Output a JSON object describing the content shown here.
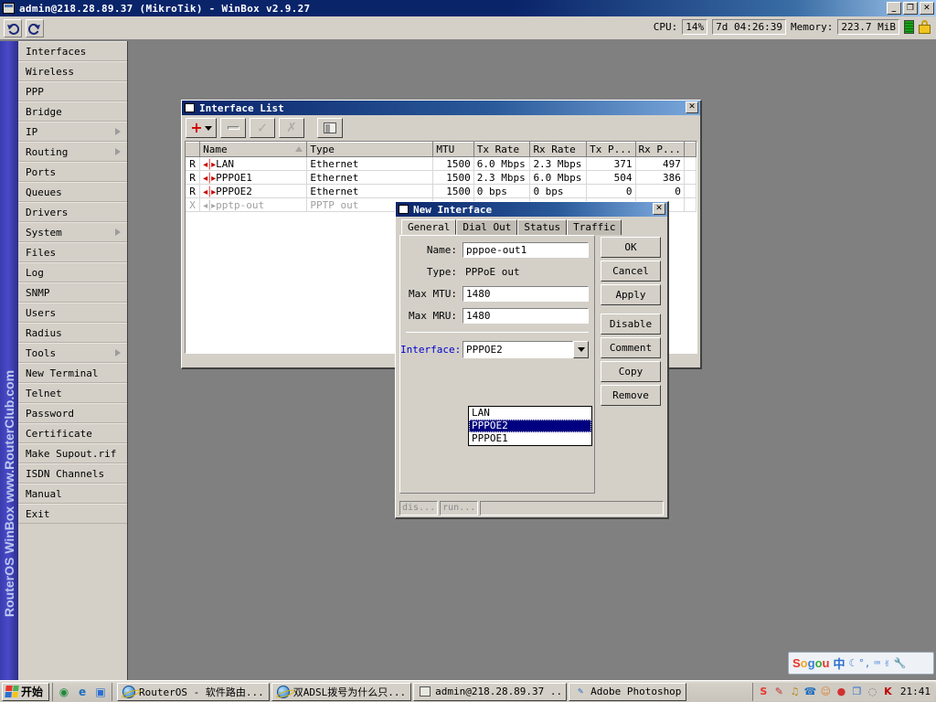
{
  "window": {
    "title": "admin@218.28.89.37 (MikroTik) - WinBox v2.9.27",
    "minimize": "_",
    "restore": "❐",
    "close": "✕"
  },
  "statusbar": {
    "cpu_label": "CPU:",
    "cpu_value": "14%",
    "uptime": "7d 04:26:39",
    "memory_label": "Memory:",
    "memory_value": "223.7 MiB"
  },
  "sidebar": {
    "watermark": "RouterOS WinBox   www.RouterClub.com",
    "items": [
      {
        "label": "Interfaces",
        "submenu": false
      },
      {
        "label": "Wireless",
        "submenu": false
      },
      {
        "label": "PPP",
        "submenu": false
      },
      {
        "label": "Bridge",
        "submenu": false
      },
      {
        "label": "IP",
        "submenu": true
      },
      {
        "label": "Routing",
        "submenu": true
      },
      {
        "label": "Ports",
        "submenu": false
      },
      {
        "label": "Queues",
        "submenu": false
      },
      {
        "label": "Drivers",
        "submenu": false
      },
      {
        "label": "System",
        "submenu": true
      },
      {
        "label": "Files",
        "submenu": false
      },
      {
        "label": "Log",
        "submenu": false
      },
      {
        "label": "SNMP",
        "submenu": false
      },
      {
        "label": "Users",
        "submenu": false
      },
      {
        "label": "Radius",
        "submenu": false
      },
      {
        "label": "Tools",
        "submenu": true
      },
      {
        "label": "New Terminal",
        "submenu": false
      },
      {
        "label": "Telnet",
        "submenu": false
      },
      {
        "label": "Password",
        "submenu": false
      },
      {
        "label": "Certificate",
        "submenu": false
      },
      {
        "label": "Make Supout.rif",
        "submenu": false
      },
      {
        "label": "ISDN Channels",
        "submenu": false
      },
      {
        "label": "Manual",
        "submenu": false
      },
      {
        "label": "Exit",
        "submenu": false
      }
    ]
  },
  "interface_list": {
    "title": "Interface List",
    "close": "✕",
    "toolbar": {
      "add": "+",
      "remove": "−",
      "enable": "✓",
      "disable": "✗",
      "comment": "window"
    },
    "columns": [
      "",
      "Name",
      "Type",
      "MTU",
      "Tx Rate",
      "Rx Rate",
      "Tx P...",
      "Rx P...",
      ""
    ],
    "rows": [
      {
        "flag": "R",
        "name": "LAN",
        "type": "Ethernet",
        "mtu": "1500",
        "tx_rate": "6.0 Mbps",
        "rx_rate": "2.3 Mbps",
        "tx_packets": "371",
        "rx_packets": "497",
        "disabled": false
      },
      {
        "flag": "R",
        "name": "PPPOE1",
        "type": "Ethernet",
        "mtu": "1500",
        "tx_rate": "2.3 Mbps",
        "rx_rate": "6.0 Mbps",
        "tx_packets": "504",
        "rx_packets": "386",
        "disabled": false
      },
      {
        "flag": "R",
        "name": "PPPOE2",
        "type": "Ethernet",
        "mtu": "1500",
        "tx_rate": "0 bps",
        "rx_rate": "0 bps",
        "tx_packets": "0",
        "rx_packets": "0",
        "disabled": false
      },
      {
        "flag": "X",
        "name": "pptp-out",
        "type": "PPTP out",
        "mtu": "",
        "tx_rate": "",
        "rx_rate": "",
        "tx_packets": "",
        "rx_packets": "",
        "disabled": true
      }
    ]
  },
  "new_interface": {
    "title": "New Interface",
    "close": "✕",
    "tabs": [
      {
        "label": "General",
        "active": true
      },
      {
        "label": "Dial Out",
        "active": false
      },
      {
        "label": "Status",
        "active": false
      },
      {
        "label": "Traffic",
        "active": false
      }
    ],
    "fields": {
      "name_label": "Name:",
      "name_value": "pppoe-out1",
      "type_label": "Type:",
      "type_value": "PPPoE out",
      "max_mtu_label": "Max MTU:",
      "max_mtu_value": "1480",
      "max_mru_label": "Max MRU:",
      "max_mru_value": "1480",
      "interface_label": "Interface:",
      "interface_value": "PPPOE2"
    },
    "dropdown": {
      "options": [
        {
          "label": "LAN",
          "selected": false
        },
        {
          "label": "PPPOE2",
          "selected": true
        },
        {
          "label": "PPPOE1",
          "selected": false
        }
      ]
    },
    "buttons": [
      {
        "label": "OK",
        "gap": false
      },
      {
        "label": "Cancel",
        "gap": false
      },
      {
        "label": "Apply",
        "gap": false
      },
      {
        "label": "Disable",
        "gap": true
      },
      {
        "label": "Comment",
        "gap": false
      },
      {
        "label": "Copy",
        "gap": false
      },
      {
        "label": "Remove",
        "gap": false
      }
    ],
    "status": {
      "disabled": "dis...",
      "running": "run...",
      "message": ""
    }
  },
  "sogou": {
    "logo": [
      {
        "ch": "S",
        "cls": "s1"
      },
      {
        "ch": "o",
        "cls": "s2"
      },
      {
        "ch": "g",
        "cls": "s3"
      },
      {
        "ch": "o",
        "cls": "s4"
      },
      {
        "ch": "u",
        "cls": "s1"
      }
    ],
    "mode": "中",
    "icons": [
      "◖",
      "°，",
      "⌨",
      "✋",
      "🔧"
    ]
  },
  "taskbar": {
    "start_label": "开始",
    "quick_launch": [
      {
        "name": "show-desktop-icon",
        "glyph": "◉",
        "color": "#1f8a3a"
      },
      {
        "name": "internet-explorer-icon",
        "glyph": "e",
        "color": "#1d6fbf"
      },
      {
        "name": "launch-app-icon",
        "glyph": "▣",
        "color": "#2a6fd0"
      }
    ],
    "tasks": [
      {
        "label": "RouterOS - 软件路由...",
        "icon": "ie"
      },
      {
        "label": "双ADSL拨号为什么只...",
        "icon": "ie"
      },
      {
        "label": "admin@218.28.89.37 ...",
        "icon": "winbox"
      },
      {
        "label": "Adobe Photoshop",
        "icon": "ps"
      }
    ],
    "tray": [
      {
        "name": "sogou-tray-icon",
        "glyph": "S",
        "color": "#e8342a"
      },
      {
        "name": "notepad-tray-icon",
        "glyph": "✎",
        "color": "#c03030"
      },
      {
        "name": "volume-tray-icon",
        "glyph": "♫",
        "color": "#b8860b"
      },
      {
        "name": "modem-tray-icon",
        "glyph": "☎",
        "color": "#1f6fbf"
      },
      {
        "name": "user-tray-icon",
        "glyph": "☺",
        "color": "#e08030"
      },
      {
        "name": "qq-tray-icon",
        "glyph": "●",
        "color": "#d03030"
      },
      {
        "name": "network-tray-icon",
        "glyph": "❐",
        "color": "#2a6fd0"
      },
      {
        "name": "disc-tray-icon",
        "glyph": "◌",
        "color": "#707070"
      },
      {
        "name": "kaspersky-tray-icon",
        "glyph": "K",
        "color": "#c00000"
      }
    ],
    "clock": "21:41"
  }
}
